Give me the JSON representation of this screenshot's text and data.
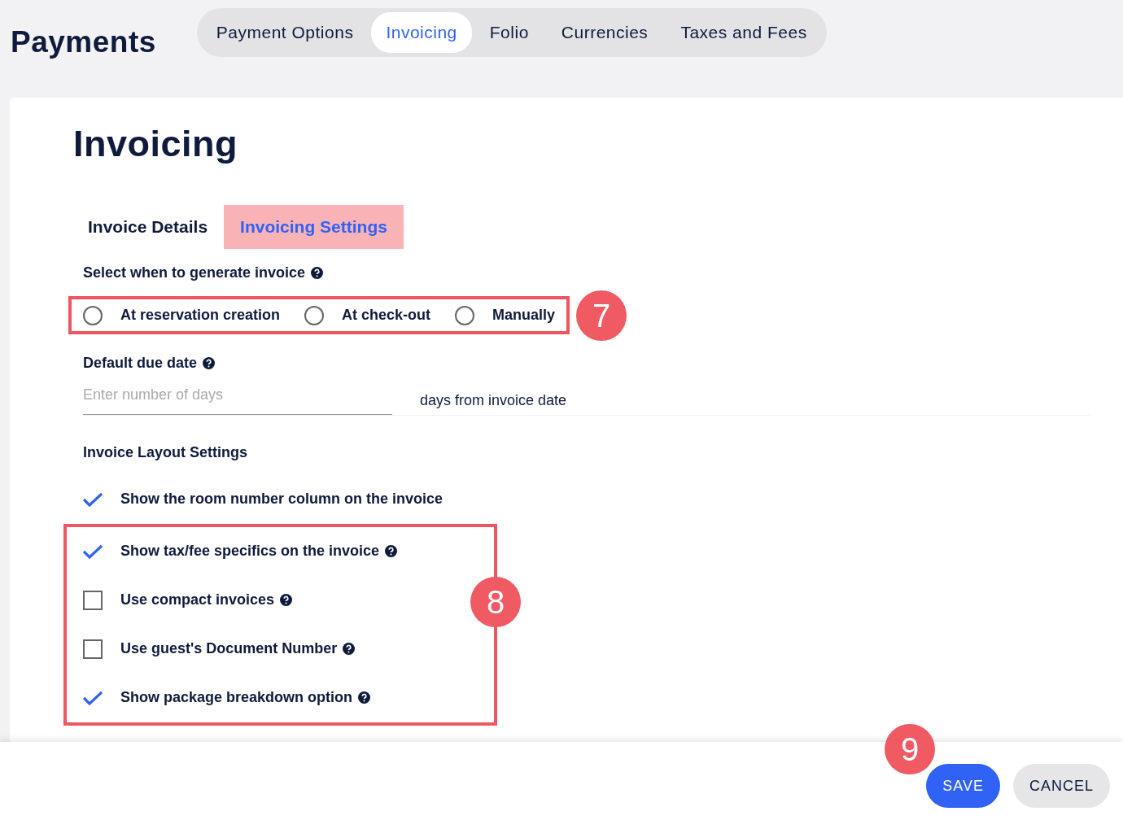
{
  "header": {
    "title": "Payments"
  },
  "tabs": [
    {
      "label": "Payment Options",
      "selected": false
    },
    {
      "label": "Invoicing",
      "selected": true
    },
    {
      "label": "Folio",
      "selected": false
    },
    {
      "label": "Currencies",
      "selected": false
    },
    {
      "label": "Taxes and Fees",
      "selected": false
    }
  ],
  "page_title": "Invoicing",
  "subtabs": [
    {
      "label": "Invoice Details",
      "selected": false
    },
    {
      "label": "Invoicing Settings",
      "selected": true
    }
  ],
  "generate_invoice": {
    "label": "Select when to generate invoice",
    "callout": "7",
    "options": [
      {
        "label": "At reservation creation",
        "selected": false
      },
      {
        "label": "At check-out",
        "selected": false
      },
      {
        "label": "Manually",
        "selected": false
      }
    ]
  },
  "due_date": {
    "label": "Default due date",
    "placeholder": "Enter number of days",
    "suffix": "days from invoice date"
  },
  "layout_settings": {
    "title": "Invoice Layout Settings",
    "options": [
      {
        "label": "Show the room number column on the invoice",
        "checked": true,
        "help": false
      }
    ],
    "highlighted_group": {
      "callout": "8",
      "options": [
        {
          "label": "Show tax/fee specifics on the invoice",
          "checked": true,
          "help": true
        },
        {
          "label": "Use compact invoices",
          "checked": false,
          "help": true
        },
        {
          "label": "Use guest's Document Number",
          "checked": false,
          "help": true
        },
        {
          "label": "Show package breakdown option",
          "checked": true,
          "help": true
        }
      ]
    }
  },
  "footer": {
    "callout": "9",
    "buttons": [
      {
        "label": "SAVE",
        "kind": "primary"
      },
      {
        "label": "CANCEL",
        "kind": "secondary"
      }
    ]
  }
}
